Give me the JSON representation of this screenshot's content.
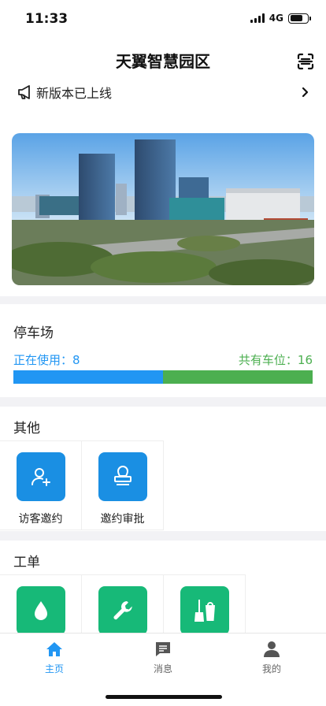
{
  "status_bar": {
    "time": "11:33",
    "network": "4G"
  },
  "header": {
    "title": "天翼智慧园区"
  },
  "notice": {
    "text": "新版本已上线"
  },
  "parking": {
    "title": "停车场",
    "in_use_label": "正在使用：8",
    "total_label": "共有车位：16",
    "in_use": 8,
    "total": 16
  },
  "others": {
    "title": "其他",
    "items": [
      {
        "label": "访客邀约",
        "icon": "add-user-icon"
      },
      {
        "label": "邀约审批",
        "icon": "stamp-icon"
      }
    ]
  },
  "work_orders": {
    "title": "工单",
    "items": [
      {
        "icon": "water-drop-icon"
      },
      {
        "icon": "wrench-icon"
      },
      {
        "icon": "cleaning-icon"
      }
    ]
  },
  "tab_bar": {
    "tabs": [
      {
        "label": "主页",
        "icon": "home-icon",
        "active": true
      },
      {
        "label": "消息",
        "icon": "message-icon",
        "active": false
      },
      {
        "label": "我的",
        "icon": "user-icon",
        "active": false
      }
    ]
  },
  "colors": {
    "accent_blue": "#2196f3",
    "accent_green": "#4caf50",
    "tile_blue": "#1a8fe3",
    "tile_green": "#17b978"
  }
}
